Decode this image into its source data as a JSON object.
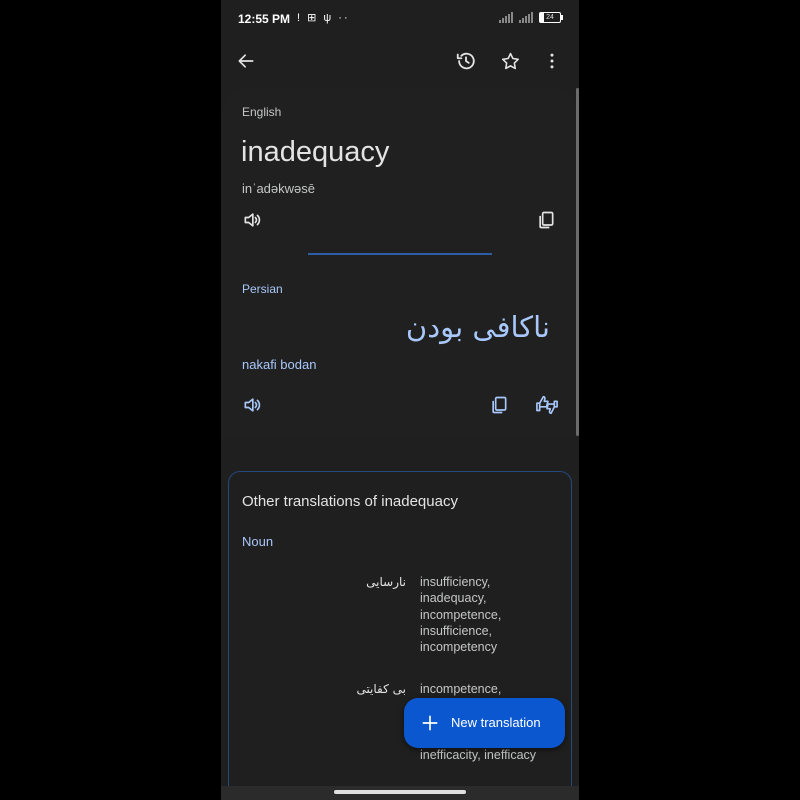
{
  "status_bar": {
    "time": "12:55 PM",
    "left_icons": "! ⊞ ψ ··",
    "battery": "24"
  },
  "app_bar": {
    "icons": [
      "back-arrow-icon",
      "history-icon",
      "star-icon",
      "more-vert-icon"
    ]
  },
  "source": {
    "language": "English",
    "text": "inadequacy",
    "phonetic": "inˈadəkwəsē"
  },
  "target": {
    "language": "Persian",
    "text": "ناکافی بودن",
    "transliteration": "nakafi bodan"
  },
  "other_translations": {
    "title": "Other translations of inadequacy",
    "part_of_speech": "Noun",
    "entries": [
      {
        "word": "نارسایی",
        "translations": "insufficiency, inadequacy, incompetence, insufficience, incompetency"
      },
      {
        "word": "بی کفایتی",
        "translations": "incompetence,"
      }
    ],
    "partial_line": "inefficacity, inefficacy"
  },
  "fab": {
    "label": "New translation"
  },
  "colors": {
    "background": "#1f1f1f",
    "accent": "#a8c7fa",
    "fab": "#0b57d0"
  }
}
